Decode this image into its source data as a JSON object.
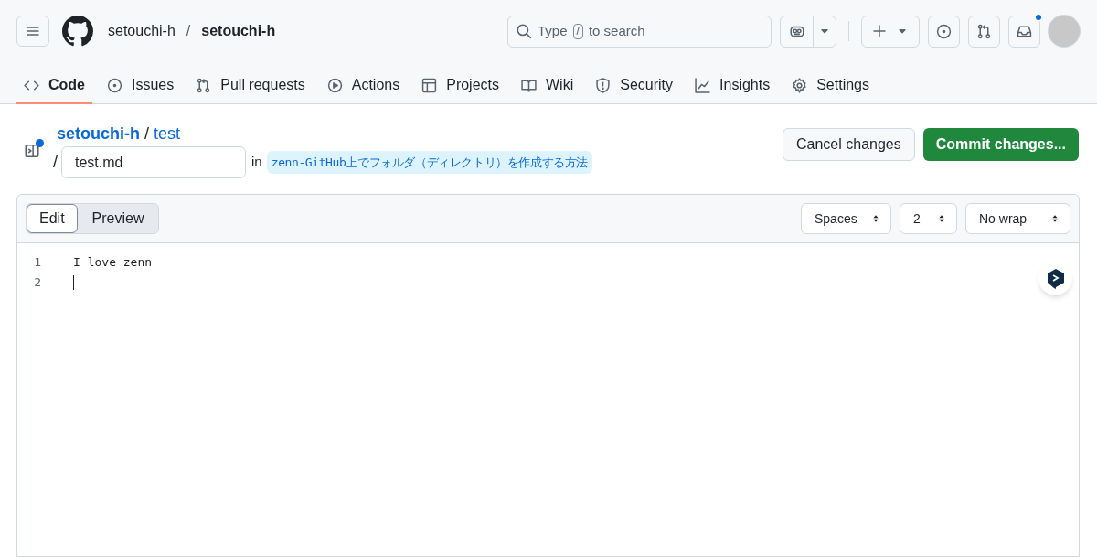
{
  "header": {
    "owner": "setouchi-h",
    "separator": "/",
    "repo": "setouchi-h",
    "search": {
      "prefix": "Type",
      "key": "/",
      "suffix": "to search"
    },
    "notifications": {
      "unread": true
    }
  },
  "tabs": [
    {
      "label": "Code",
      "selected": true
    },
    {
      "label": "Issues",
      "selected": false
    },
    {
      "label": "Pull requests",
      "selected": false
    },
    {
      "label": "Actions",
      "selected": false
    },
    {
      "label": "Projects",
      "selected": false
    },
    {
      "label": "Wiki",
      "selected": false
    },
    {
      "label": "Security",
      "selected": false
    },
    {
      "label": "Insights",
      "selected": false
    },
    {
      "label": "Settings",
      "selected": false
    }
  ],
  "breadcrumb": {
    "owner": "setouchi-h",
    "separator": "/",
    "repo": "test",
    "path_separator": "/",
    "filename": "test.md",
    "in_label": "in",
    "branch": "zenn-GitHub上でフォルダ（ディレクトリ）を作成する方法"
  },
  "actions": {
    "cancel": "Cancel changes",
    "commit": "Commit changes..."
  },
  "editor": {
    "modes": [
      {
        "label": "Edit",
        "selected": true
      },
      {
        "label": "Preview",
        "selected": false
      }
    ],
    "selects": [
      "Spaces",
      "2",
      "No wrap"
    ],
    "lines": [
      {
        "number": "1",
        "text": "I love zenn",
        "cursor": false
      },
      {
        "number": "2",
        "cursor": true
      }
    ]
  }
}
